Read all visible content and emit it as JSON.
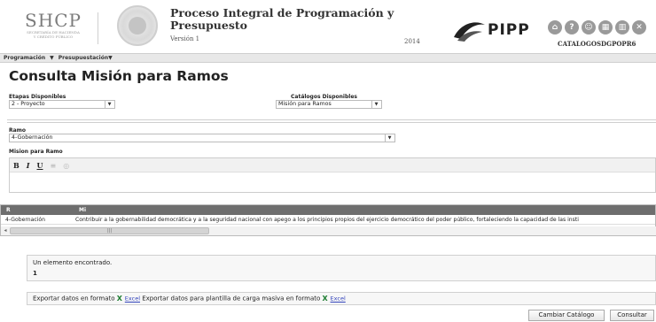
{
  "header": {
    "logo_text": "SHCP",
    "logo_subtitle_1": "SECRETARÍA DE HACIENDA",
    "logo_subtitle_2": "Y CRÉDITO PÚBLICO",
    "system_title": "Proceso Integral de Programación y Presupuesto",
    "version": "Versión 1",
    "year": "2014",
    "system_logo": "PIPP",
    "user": "CATALOGOSDGPOPR6",
    "icons": [
      "home-icon",
      "help-icon",
      "users-icon",
      "calendar-icon",
      "book-icon",
      "close-icon"
    ]
  },
  "menu": {
    "items": [
      "Programación",
      "▼",
      "Presupuestación▼"
    ]
  },
  "page": {
    "title": "Consulta Misión para Ramos"
  },
  "filters": {
    "etapas_label": "Etapas Disponibles",
    "etapas_value": "2 - Proyecto",
    "catalogos_label": "Catálogos Disponibles",
    "catalogos_value": "Misión para Ramos",
    "ramo_label": "Ramo",
    "ramo_value": "4-Gobernación",
    "mision_label": "Mision para Ramo"
  },
  "editor": {
    "bold": "B",
    "italic": "I",
    "underline": "U",
    "list": "≡",
    "extra": "◎"
  },
  "grid": {
    "columns": [
      "R",
      "Mi"
    ],
    "rows": [
      {
        "ramo": "4-Gobernación",
        "mision": "Contribuir a la gobernabilidad democrática y a la seguridad nacional con apego a los principios propios del ejercicio democrático del poder público, fortaleciendo la capacidad de las insti"
      }
    ],
    "scroll_left": "◂",
    "scroll_thumb": "|||"
  },
  "result": {
    "message": "Un elemento encontrado.",
    "count": "1"
  },
  "export": {
    "text1": "Exportar datos en formato",
    "link1": "Excel",
    "text2": "Exportar datos para plantilla de carga masiva en formato",
    "link2": "Excel",
    "excel_glyph": "X"
  },
  "buttons": {
    "change_catalog": "Cambiar Catálogo",
    "consult": "Consultar"
  }
}
